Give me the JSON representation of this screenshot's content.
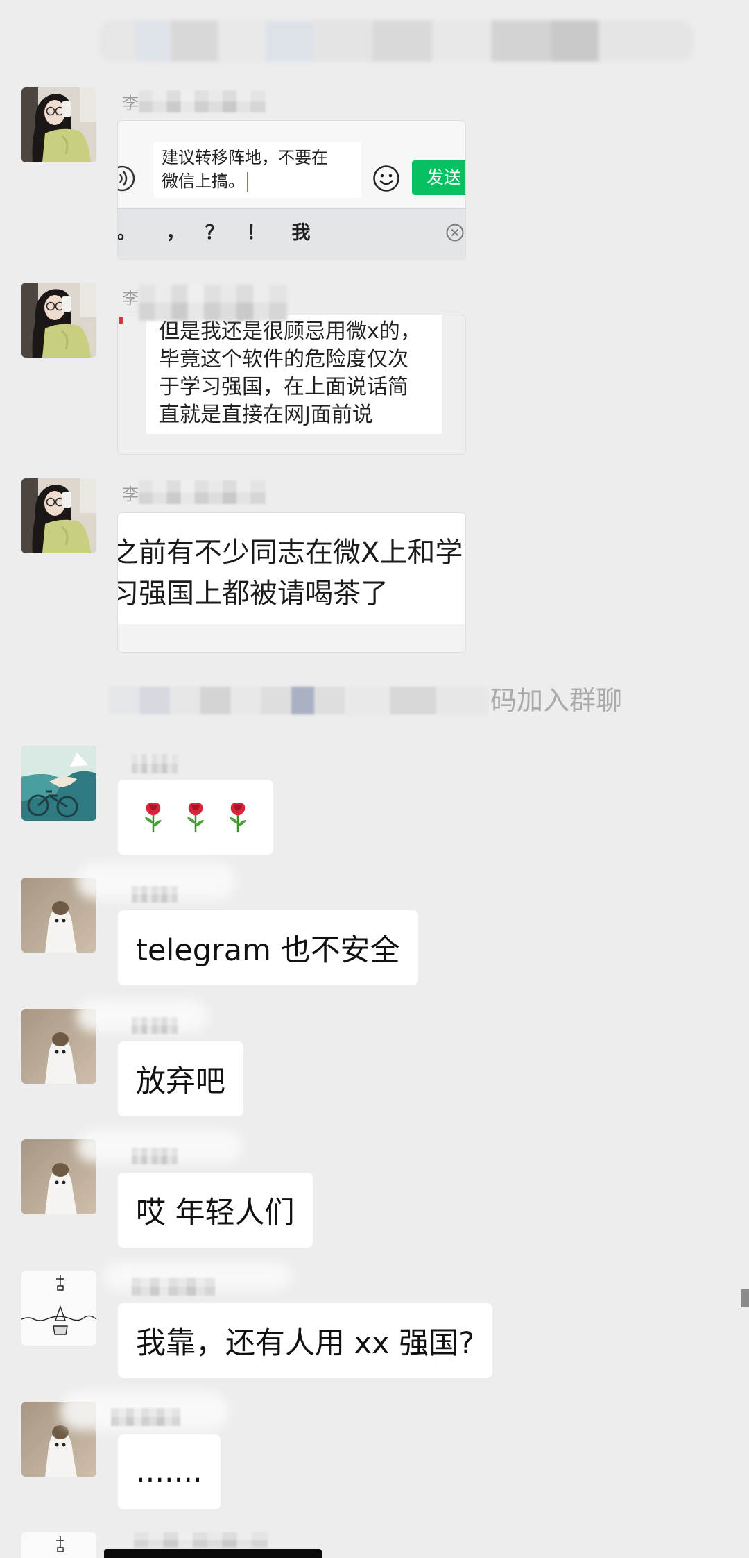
{
  "colors": {
    "page_background": "#ededed",
    "bubble_background": "#ffffff",
    "send_button": "#07c160",
    "message_text": "#111111",
    "system_text": "#aaaaaa"
  },
  "chat": {
    "messages": [
      {
        "sender": "李",
        "image": {
          "input_lines": [
            "建议转移阵地，不要在",
            "微信上搞。"
          ],
          "send_label": "发送",
          "keyboard_keys": [
            "。",
            "，",
            "？",
            "！",
            "我"
          ],
          "icons": [
            "voice-icon",
            "smiley-icon",
            "clear-icon"
          ]
        }
      },
      {
        "sender": "李",
        "image": {
          "lines": [
            "但是我还是很顾忌用微x的，",
            "毕竟这个软件的危险度仅次",
            "于学习强国，在上面说话简",
            "直就是直接在网J面前说"
          ]
        }
      },
      {
        "sender": "李",
        "image": {
          "lines": [
            "之前有不少同志在微X上和学",
            "习强国上都被请喝茶了"
          ]
        }
      },
      {
        "emoji": [
          "rose-icon",
          "rose-icon",
          "rose-icon"
        ]
      },
      {
        "text": "telegram 也不安全"
      },
      {
        "text": "放弃吧"
      },
      {
        "text": "哎 年轻人们"
      },
      {
        "text": "我靠，还有人用 xx 强国?"
      },
      {
        "text": "......."
      }
    ],
    "system_notice": "码加入群聊"
  }
}
